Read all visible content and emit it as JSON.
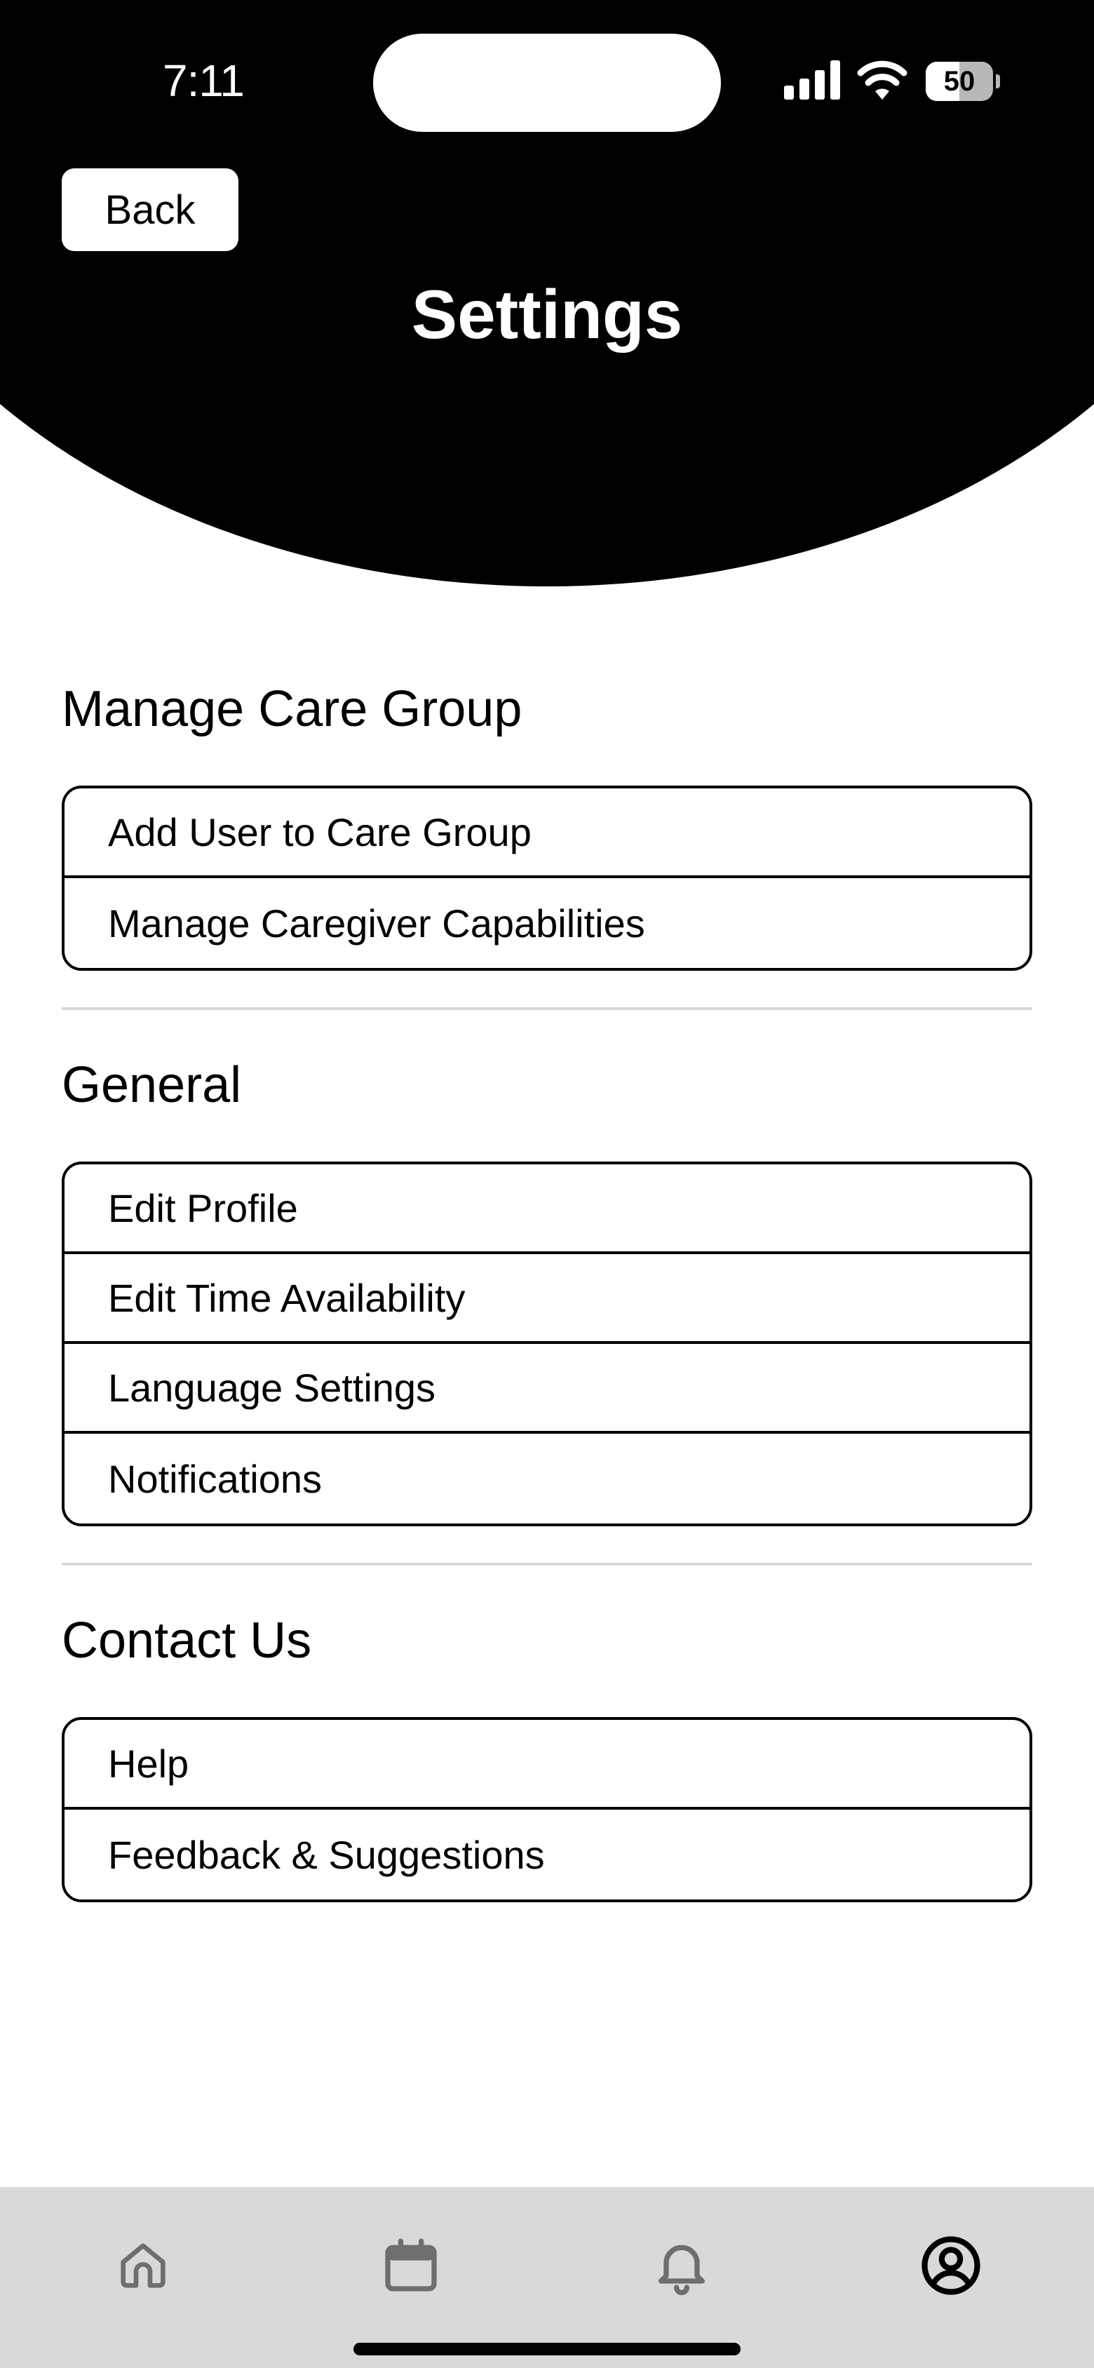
{
  "status_bar": {
    "time": "7:11",
    "battery_level": "50",
    "battery_fraction": 0.5,
    "icons": [
      "signal-icon",
      "wifi-icon",
      "battery-icon"
    ]
  },
  "header": {
    "back_label": "Back",
    "title": "Settings"
  },
  "sections": [
    {
      "title": "Manage Care Group",
      "items": [
        "Add User to Care Group",
        "Manage Caregiver Capabilities"
      ]
    },
    {
      "title": "General",
      "items": [
        "Edit Profile",
        "Edit Time Availability",
        "Language Settings",
        "Notifications"
      ]
    },
    {
      "title": "Contact Us",
      "items": [
        "Help",
        "Feedback & Suggestions"
      ]
    }
  ],
  "tab_bar": {
    "tabs": [
      {
        "icon": "home-icon",
        "active": false
      },
      {
        "icon": "calendar-icon",
        "active": false
      },
      {
        "icon": "bell-icon",
        "active": false
      },
      {
        "icon": "profile-icon",
        "active": true
      }
    ],
    "active_color": "#000000",
    "inactive_color": "#6e6e6e",
    "background": "#d9d9d9"
  },
  "colors": {
    "header_background": "#000000",
    "divider": "#d9d9d9"
  }
}
